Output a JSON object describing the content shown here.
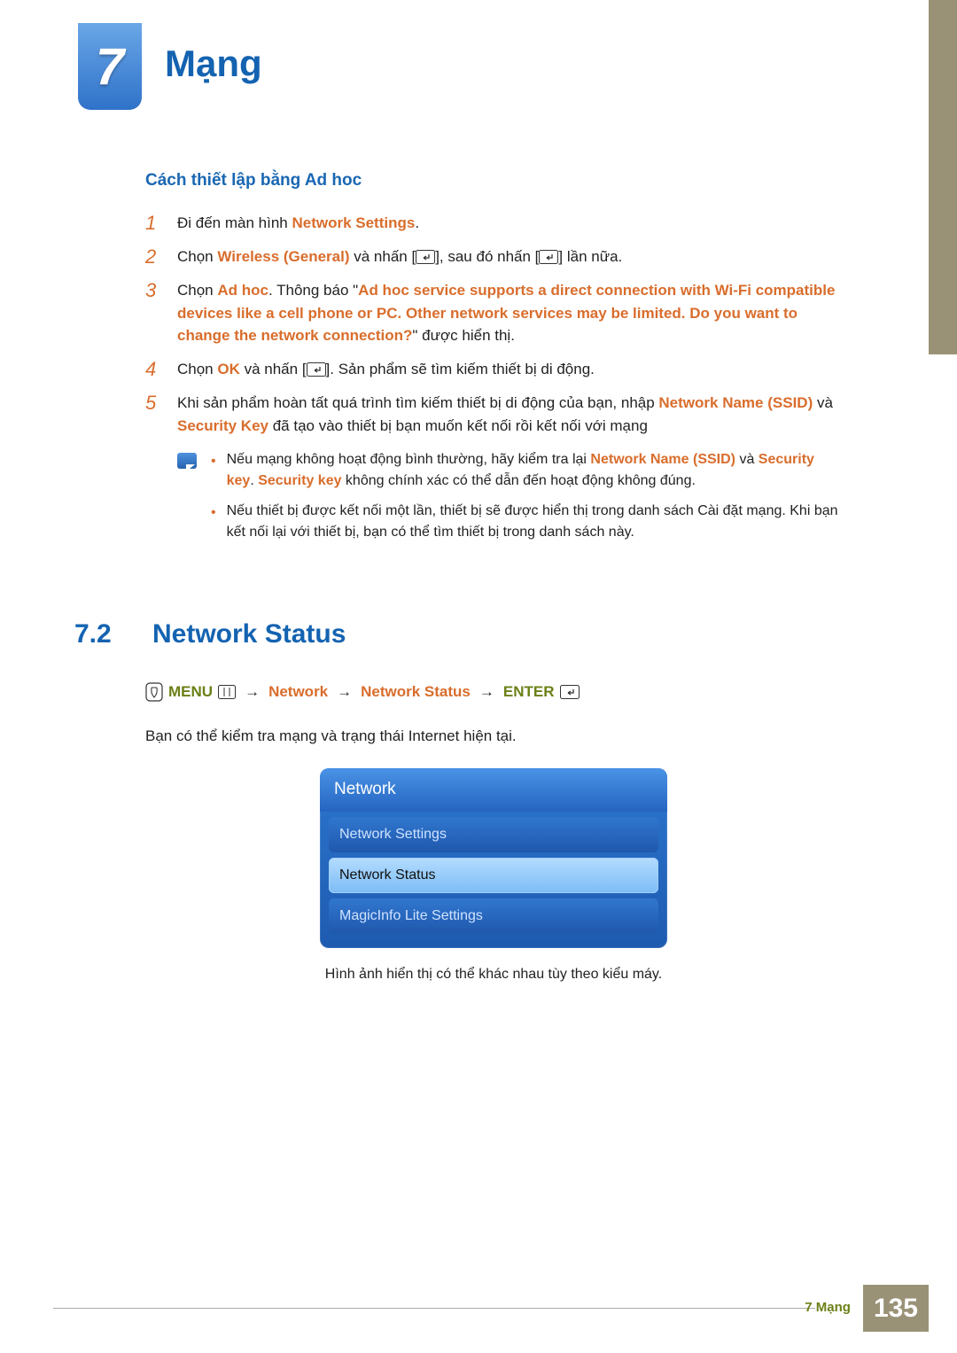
{
  "chapter": {
    "number": "7",
    "title": "Mạng"
  },
  "subheading": "Cách thiết lập bằng Ad hoc",
  "steps": {
    "1": {
      "pre": "Đi đến màn hình ",
      "link": "Network Settings",
      "post": "."
    },
    "2": {
      "t1": "Chọn ",
      "wireless": "Wireless (General)",
      "t2": " và nhấn [",
      "t3": "], sau đó nhấn [",
      "t4": "] lần nữa."
    },
    "3": {
      "t1": "Chọn ",
      "adhoc": "Ad hoc",
      "t2": ". Thông báo \"",
      "msg": "Ad hoc service supports a direct connection with Wi-Fi compatible devices like a cell phone or PC. Other network services may be limited. Do you want to change the network connection?",
      "t3": "\" được hiển thị."
    },
    "4": {
      "t1": "Chọn ",
      "ok": "OK",
      "t2": " và nhấn [",
      "t3": "]. Sản phẩm sẽ tìm kiếm thiết bị di động."
    },
    "5": {
      "t1": "Khi sản phẩm hoàn tất quá trình tìm kiếm thiết bị di động của bạn, nhập ",
      "ssid": "Network Name (SSID)",
      "t2": " và ",
      "skey": "Security Key",
      "t3": " đã tạo vào thiết bị bạn muốn kết nối rồi kết nối với mạng"
    }
  },
  "notes": {
    "n1": {
      "t1": "Nếu mạng không hoạt động bình thường, hãy kiểm tra lại ",
      "ssid": "Network Name (SSID)",
      "t2": " và ",
      "skey1": "Security key",
      "t3": ". ",
      "skey2": "Security key",
      "t4": " không chính xác có thể dẫn đến hoạt động không đúng."
    },
    "n2": "Nếu thiết bị được kết nối một lần, thiết bị sẽ được hiển thị trong danh sách Cài đặt mạng. Khi bạn kết nối lại với thiết bị, bạn có thể tìm thiết bị trong danh sách này."
  },
  "section": {
    "num": "7.2",
    "title": "Network Status"
  },
  "navpath": {
    "menu": "MENU",
    "n1": "Network",
    "n2": "Network Status",
    "enter": "ENTER",
    "arrow": "→"
  },
  "desc": "Bạn có thể kiểm tra mạng và trạng thái Internet hiện tại.",
  "menu": {
    "header": "Network",
    "items": [
      "Network Settings",
      "Network Status",
      "MagicInfo Lite Settings"
    ],
    "caption": "Hình ảnh hiển thị có thể khác nhau tùy theo kiểu máy."
  },
  "footer": {
    "text": "7 Mạng",
    "page": "135"
  }
}
